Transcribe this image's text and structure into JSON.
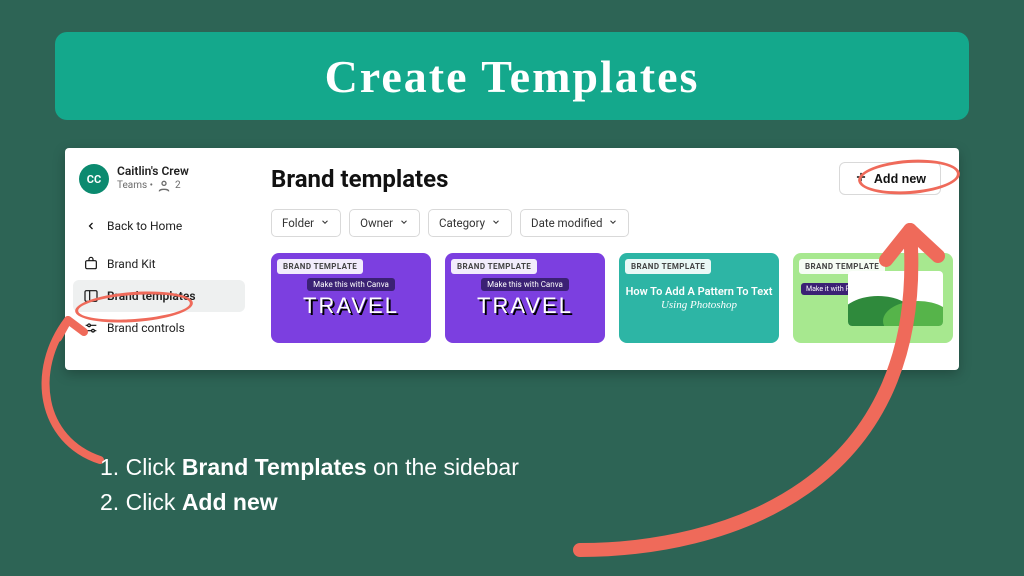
{
  "banner": {
    "title": "Create Templates"
  },
  "sidebar": {
    "avatar_initials": "CC",
    "team_name": "Caitlin's Crew",
    "team_sub_prefix": "Teams •",
    "team_member_count": "2",
    "back_label": "Back to Home",
    "items": [
      {
        "label": "Brand Kit"
      },
      {
        "label": "Brand templates"
      },
      {
        "label": "Brand controls"
      }
    ]
  },
  "main": {
    "title": "Brand templates",
    "add_label": "Add new",
    "filters": [
      {
        "label": "Folder"
      },
      {
        "label": "Owner"
      },
      {
        "label": "Category"
      },
      {
        "label": "Date modified"
      }
    ],
    "card_tag": "BRAND TEMPLATE",
    "cards": {
      "travel_ribbon": "Make this with Canva",
      "travel_big": "TRAVEL",
      "pattern_line1": "How To Add A Pattern To Text",
      "pattern_line2": "Using Photoshop",
      "green_label": "Make it with Photoshop"
    }
  },
  "instructions": {
    "step1_prefix": "Click ",
    "step1_bold": "Brand Templates",
    "step1_suffix": " on the sidebar",
    "step2_prefix": "Click ",
    "step2_bold": "Add new"
  },
  "colors": {
    "annotation": "#ef6a5a"
  }
}
